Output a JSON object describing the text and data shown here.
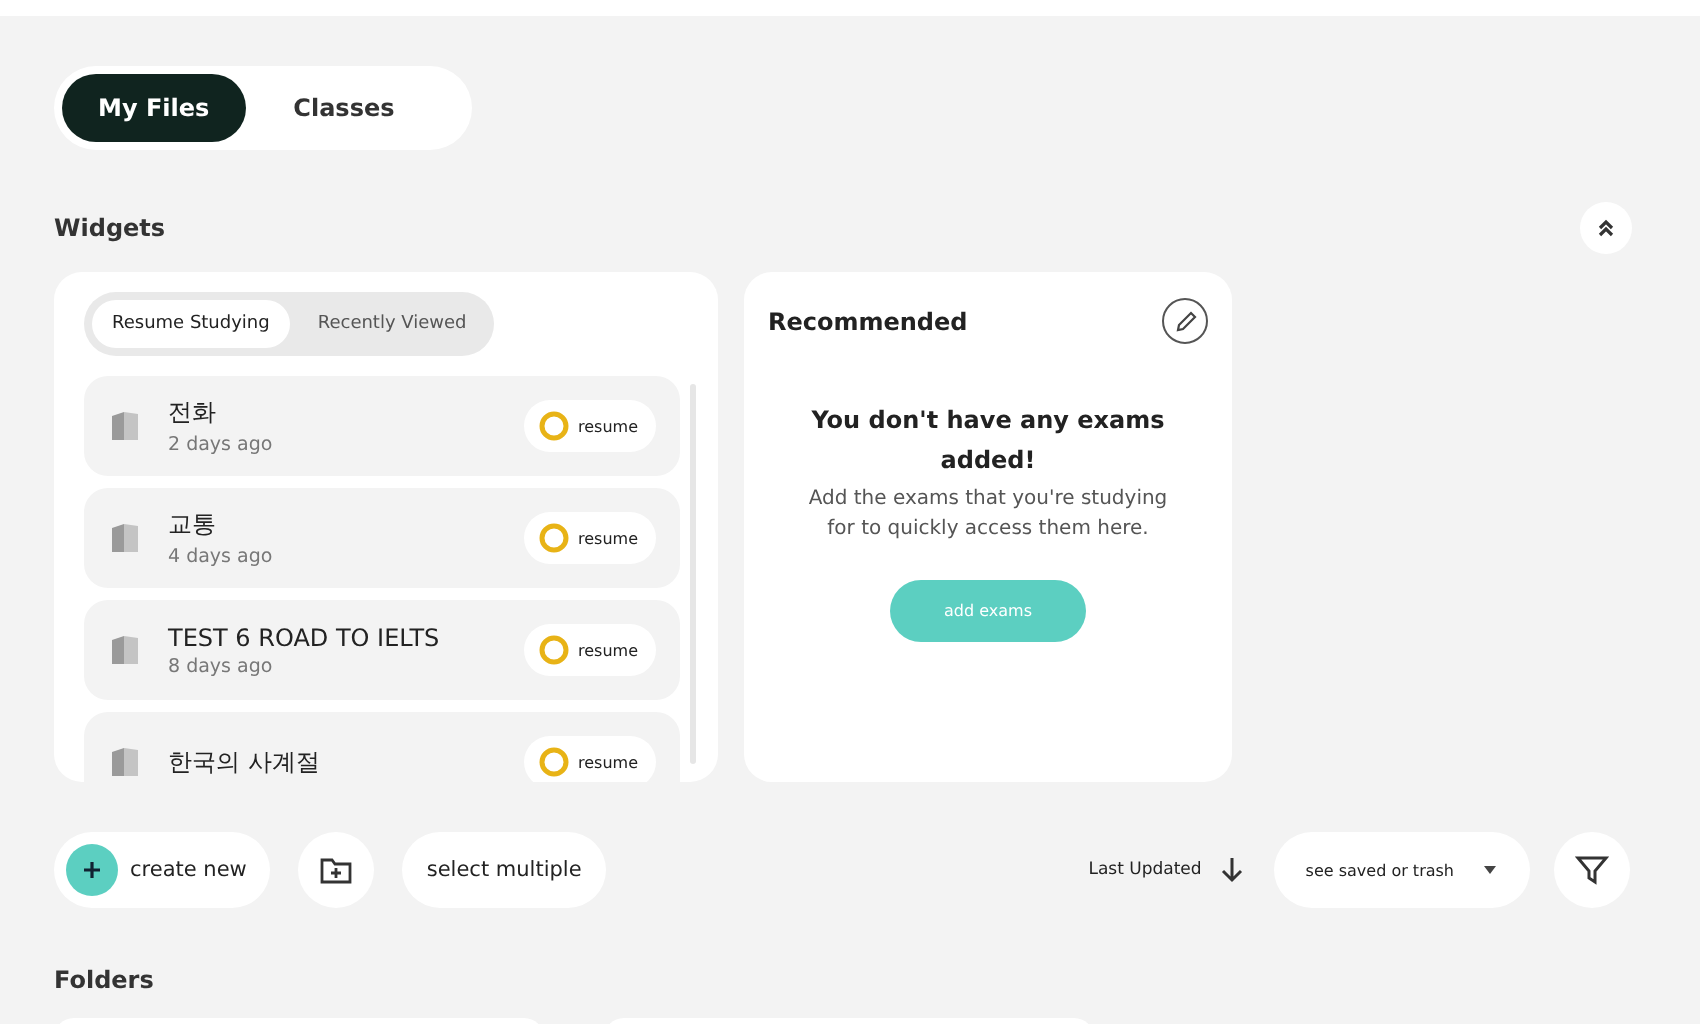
{
  "view_tabs": [
    {
      "label": "My Files",
      "selected": true
    },
    {
      "label": "Classes",
      "selected": false
    }
  ],
  "widgets": {
    "title": "Widgets",
    "study": {
      "tabs": [
        {
          "label": "Resume Studying",
          "selected": true
        },
        {
          "label": "Recently Viewed",
          "selected": false
        }
      ],
      "items": [
        {
          "title": "전화",
          "time": "2 days ago",
          "action": "resume"
        },
        {
          "title": "교통",
          "time": "4 days ago",
          "action": "resume"
        },
        {
          "title": "TEST 6 ROAD TO IELTS",
          "time": "8 days ago",
          "action": "resume"
        },
        {
          "title": "한국의 사계절",
          "action": "resume"
        }
      ]
    },
    "recommended": {
      "title": "Recommended",
      "heading": "You don't have any exams added!",
      "text": "Add the exams that you're studying for to quickly access them here.",
      "button": "add exams"
    }
  },
  "toolbar": {
    "create": "create new",
    "select": "select multiple",
    "sort": "Last Updated",
    "filter": "see saved or trash"
  },
  "folders": {
    "title": "Folders"
  }
}
